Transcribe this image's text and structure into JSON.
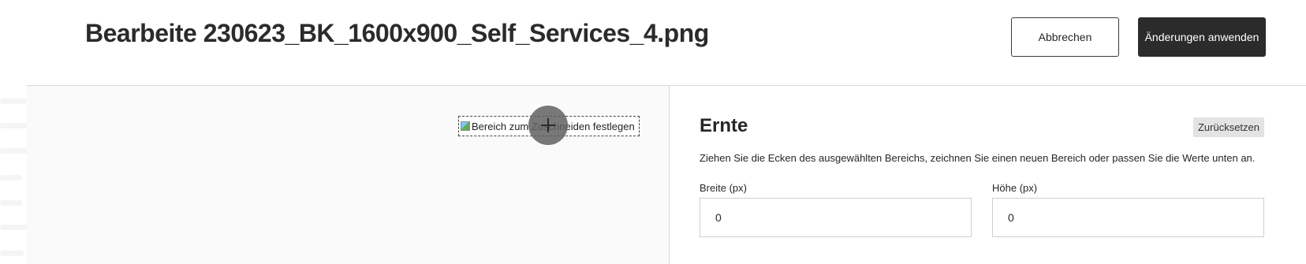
{
  "header": {
    "title": "Bearbeite 230623_BK_1600x900_Self_Services_4.png",
    "cancel_label": "Abbrechen",
    "apply_label": "Änderungen anwenden"
  },
  "preview": {
    "image_alt": "Bereich zum Zuschneiden festlegen"
  },
  "crop_panel": {
    "title": "Ernte",
    "reset_label": "Zurücksetzen",
    "instructions": "Ziehen Sie die Ecken des ausgewählten Bereichs, zeichnen Sie einen neuen Bereich oder passen Sie die Werte unten an.",
    "width_label": "Breite (px)",
    "width_value": "0",
    "height_label": "Höhe (px)",
    "height_value": "0"
  },
  "colors": {
    "primary_button": "#2b2b2b",
    "reset_button": "#e3e3e3",
    "divider": "#d9d9d9"
  }
}
